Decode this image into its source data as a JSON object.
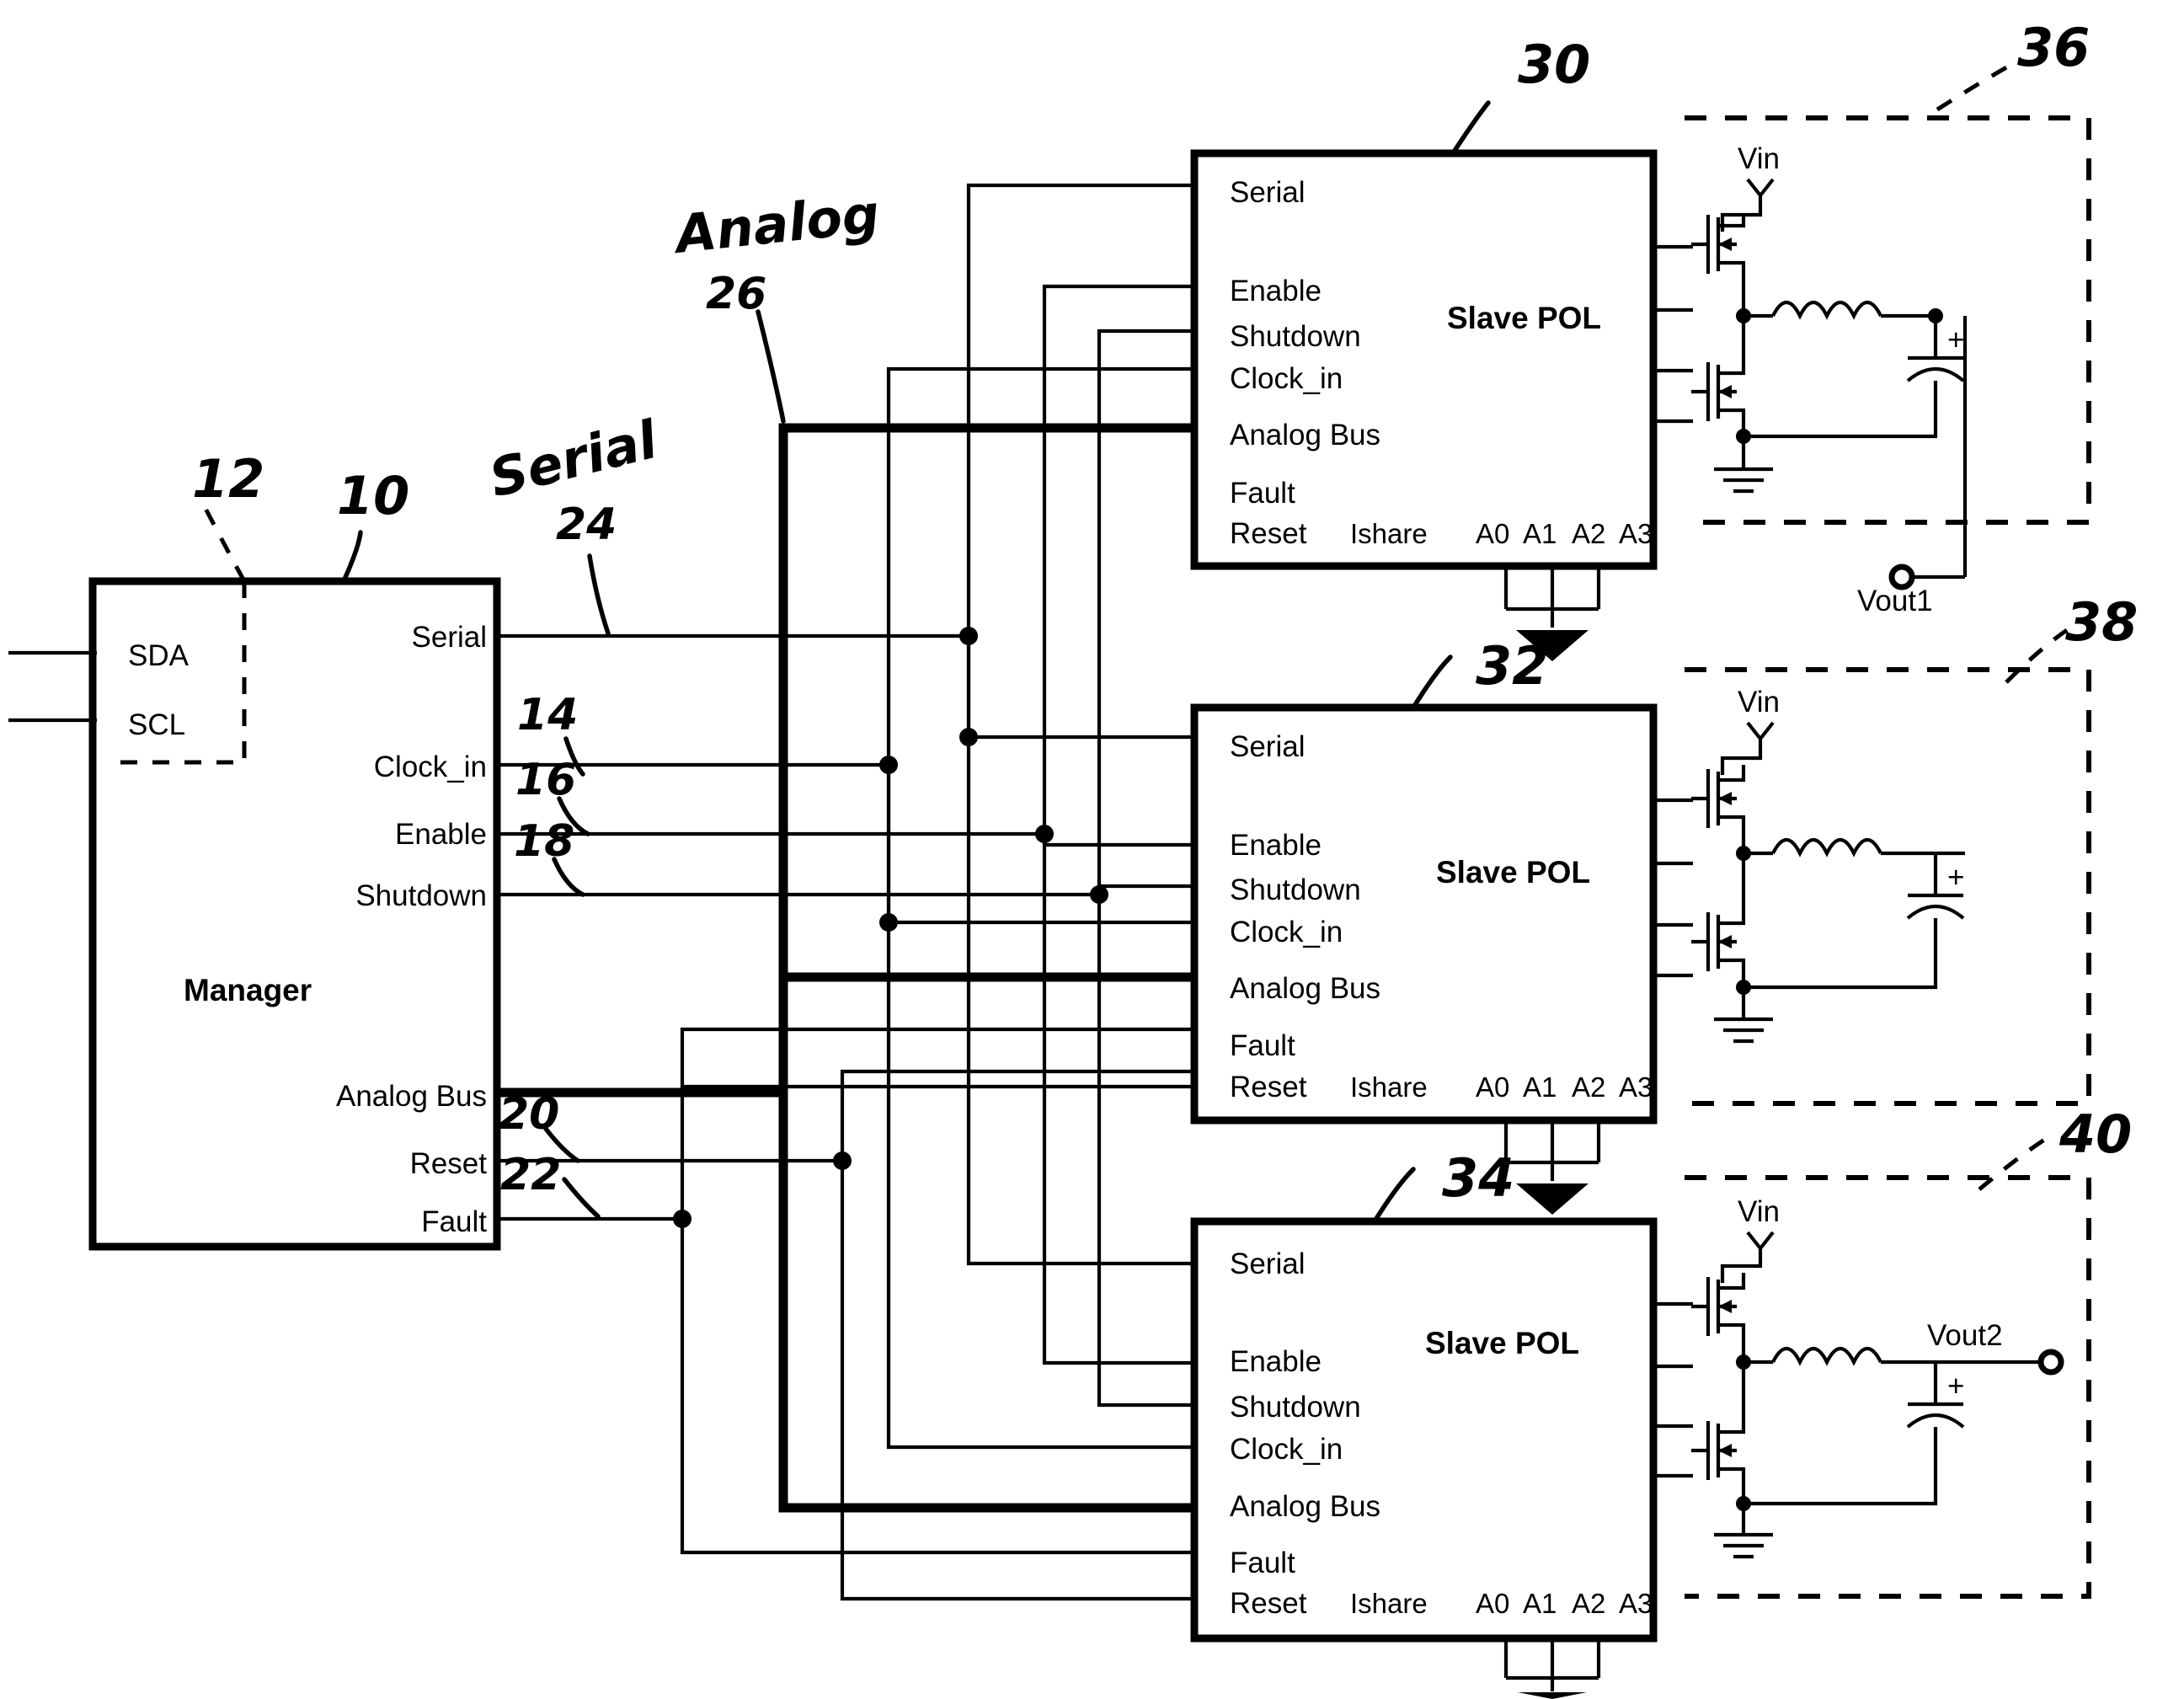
{
  "figure": {
    "kind": "patent-circuit-diagram",
    "description": "Power management system with a Manager controller driving three Slave POL converters over serial, clock, enable, shutdown, analog bus, reset and fault nets."
  },
  "manager": {
    "title": "Manager",
    "ref": "10",
    "sub_block_ref": "12",
    "left_pins": [
      "SDA",
      "SCL"
    ],
    "right_pins": [
      {
        "label": "Serial",
        "net_ref": "24",
        "net_name": "Serial"
      },
      {
        "label": "Clock_in",
        "net_ref": "14"
      },
      {
        "label": "Enable",
        "net_ref": "16"
      },
      {
        "label": "Shutdown",
        "net_ref": "18"
      },
      {
        "label": "Analog Bus",
        "net_ref": "26",
        "net_name": "Analog"
      },
      {
        "label": "Reset",
        "net_ref": "20"
      },
      {
        "label": "Fault",
        "net_ref": "22"
      }
    ]
  },
  "net_labels": [
    {
      "text": "Serial",
      "ref": "24"
    },
    {
      "text": "Analog",
      "ref": "26"
    }
  ],
  "slaves": [
    {
      "title": "Slave POL",
      "ref": "30",
      "left_pins": [
        "Serial",
        "Enable",
        "Shutdown",
        "Clock_in",
        "Analog Bus",
        "Fault",
        "Reset"
      ],
      "bottom_pins": [
        "Ishare",
        "A0",
        "A1",
        "A2",
        "A3"
      ]
    },
    {
      "title": "Slave POL",
      "ref": "32",
      "left_pins": [
        "Serial",
        "Enable",
        "Shutdown",
        "Clock_in",
        "Analog Bus",
        "Fault",
        "Reset"
      ],
      "bottom_pins": [
        "Ishare",
        "A0",
        "A1",
        "A2",
        "A3"
      ]
    },
    {
      "title": "Slave POL",
      "ref": "34",
      "left_pins": [
        "Serial",
        "Enable",
        "Shutdown",
        "Clock_in",
        "Analog Bus",
        "Fault",
        "Reset"
      ],
      "bottom_pins": [
        "Ishare",
        "A0",
        "A1",
        "A2",
        "A3"
      ]
    }
  ],
  "power_stages": [
    {
      "ref": "36",
      "vin": "Vin",
      "vout": "Vout1",
      "has_output_terminal": true
    },
    {
      "ref": "38",
      "vin": "Vin",
      "vout": "",
      "has_output_terminal": false
    },
    {
      "ref": "40",
      "vin": "Vin",
      "vout": "Vout2",
      "has_output_terminal": true
    }
  ],
  "ref_numerals": [
    "10",
    "12",
    "14",
    "16",
    "18",
    "20",
    "22",
    "24",
    "26",
    "30",
    "32",
    "34",
    "36",
    "38",
    "40"
  ],
  "colors": {
    "ink": "#000000",
    "paper": "#ffffff"
  }
}
